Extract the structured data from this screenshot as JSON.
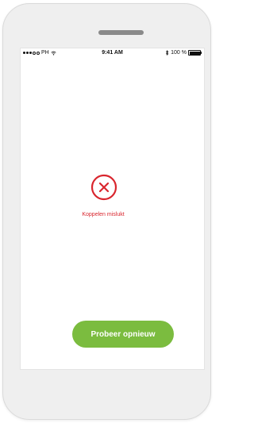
{
  "status_bar": {
    "carrier": "PH",
    "time": "9:41 AM",
    "battery": "100 %"
  },
  "icons": {
    "wifi": "wifi-icon",
    "bluetooth": "bluetooth-icon",
    "battery": "battery-icon",
    "error": "error-circle-x-icon"
  },
  "main": {
    "error_message": "Koppelen mislukt",
    "retry_label": "Probeer opnieuw"
  },
  "colors": {
    "error": "#d9262e",
    "accent": "#7bbc3f"
  }
}
